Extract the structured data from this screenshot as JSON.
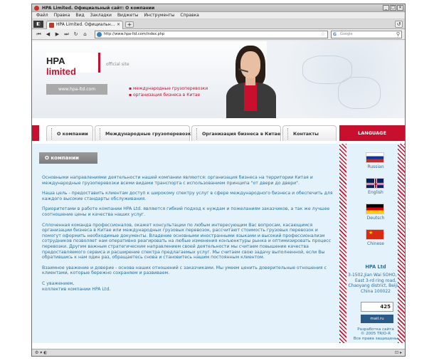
{
  "browser": {
    "title": "HPA Limited. Официальный сайт: О компании",
    "menu": [
      "Файл",
      "Правка",
      "Вид",
      "Закладки",
      "Виджеты",
      "Инструменты",
      "Справка"
    ],
    "tab_label": "HPA Limited. Официальн...",
    "url": "http://www.hpa-ltd.com/index.php",
    "search_placeholder": "Google"
  },
  "header": {
    "logo_main": "HPA ",
    "logo_accent": "limited",
    "official_site": "official site",
    "site_url": "www.hpa-ltd.com",
    "services": [
      "международные грузоперевозки",
      "организация бизнеса в Китае"
    ]
  },
  "nav": {
    "items": [
      "О компании",
      "Международные грузоперевозки",
      "Организация бизнеса в Китае",
      "Контакты"
    ],
    "language": "LANGUAGE"
  },
  "main": {
    "section_title": "О компании",
    "paragraphs": [
      "Основными направлениями деятельности нашей компании являются: организация бизнеса на территории Китая и международные грузоперевозки всеми видами транспорта с использованием принципа \"от двери до двери\".",
      "Наша цель - предоставить клиентам доступ к широкому спектру услуг в сфере международного бизнеса и обеспечить для каждого высокие стандарты обслуживания.",
      "Приоритетами в работе компании HPA Ltd. являются гибкий подход к нуждам и пожеланиям заказчиков, а так же лучшее соотношение цены и качества наших услуг.",
      "Сплоченная команда профессионалов, окажет консультации по любым интересующим Вас вопросам, касающимся организации бизнеса в Китае или международных грузовых перевозок, рассчитают стоимость грузовых перевозок и помогут оформить необходимые документы. Владение основными иностранными языками и высокий профессионализм сотрудников позволяет нам оперативно реагировать на любые изменения конъюнктуры рынка и оптимизировать процесс перевозки. Другим важным стратегическим направлением своей деятельности мы считаем повышение качества предоставляемого сервиса и расширение спектра предлагаемых услуг. Мы считаем свою задачу выполненной, если Вы обратившись к нам один раз, обращаетесь снова и становитесь нашим постоянным клиентом.",
      "Взаимное уважение и доверие - основа наших отношений с заказчиками. Мы умеем ценить доверительные отношения с клиентами, которые бережно сохраняем и развиваем.",
      "С уважением,\nколлектив компании HPA Ltd."
    ]
  },
  "sidebar": {
    "languages": [
      "Russian",
      "English",
      "Deutsch",
      "Chinese"
    ],
    "company_name": "HPA Ltd",
    "address": "3-1502,Jian Wai SOHO, 39 East 3-rd ring road, Chaoyang district, Beijing China 100022",
    "counter": "425",
    "counter2": "mail.ru",
    "credits": [
      "Разработка сайта",
      "© 2005 TRIO-R",
      "Все права защищены"
    ]
  },
  "colors": {
    "brand_red": "#c8102e",
    "text_blue": "#2f6f9b",
    "content_bg": "#e3f2fb"
  }
}
